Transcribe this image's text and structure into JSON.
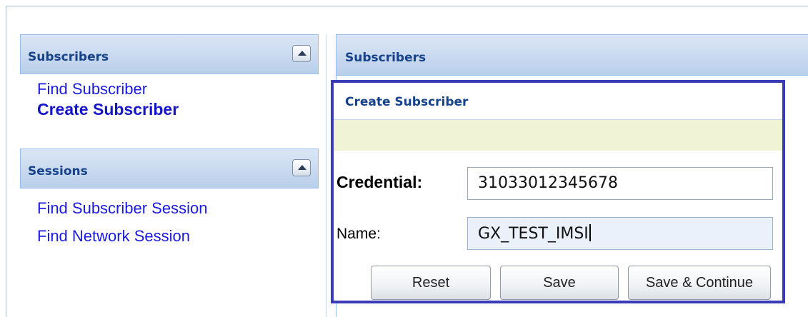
{
  "sidebar": {
    "subscribers": {
      "title": "Subscribers",
      "items": [
        {
          "label": "Find Subscriber"
        },
        {
          "label": "Create Subscriber"
        }
      ]
    },
    "sessions": {
      "title": "Sessions",
      "items": [
        {
          "label": "Find Subscriber Session"
        },
        {
          "label": "Find Network Session"
        }
      ]
    }
  },
  "main": {
    "title": "Subscribers",
    "form": {
      "title": "Create Subscriber",
      "credential_label": "Credential:",
      "credential_value": "31033012345678",
      "name_label": "Name:",
      "name_value": "GX_TEST_IMSI",
      "buttons": {
        "reset": "Reset",
        "save": "Save",
        "save_continue": "Save & Continue"
      }
    }
  },
  "colors": {
    "header_text": "#15428b",
    "link": "#1a1ae0",
    "highlight_border": "#3b3bb8",
    "notice_bar": "#f0f3d5"
  },
  "icons": {
    "collapse": "chevron-up-icon"
  }
}
